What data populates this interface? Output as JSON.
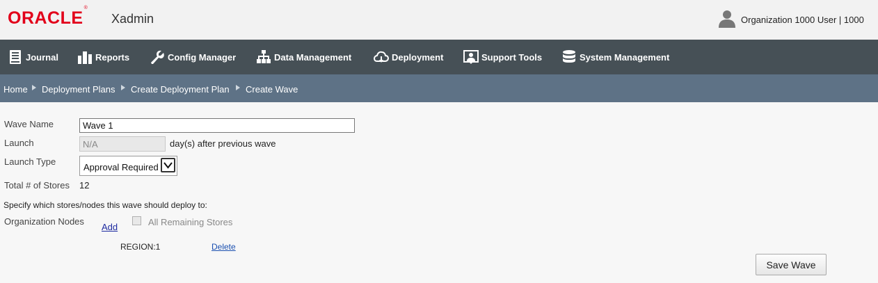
{
  "header": {
    "brand": "ORACLE",
    "trademark": "®",
    "app_name": "Xadmin",
    "user_label": "Organization 1000 User | 1000"
  },
  "nav": {
    "items": [
      {
        "label": "Journal",
        "icon": "journal-icon"
      },
      {
        "label": "Reports",
        "icon": "reports-icon"
      },
      {
        "label": "Config Manager",
        "icon": "wrench-icon"
      },
      {
        "label": "Data Management",
        "icon": "hierarchy-icon"
      },
      {
        "label": "Deployment",
        "icon": "cloud-download-icon"
      },
      {
        "label": "Support Tools",
        "icon": "support-icon"
      },
      {
        "label": "System Management",
        "icon": "database-icon"
      }
    ]
  },
  "breadcrumb": [
    "Home",
    "Deployment Plans",
    "Create Deployment Plan",
    "Create Wave"
  ],
  "form": {
    "wave_name_label": "Wave Name",
    "wave_name_value": "Wave 1",
    "launch_label": "Launch",
    "launch_value": "N/A",
    "launch_suffix": "day(s) after previous wave",
    "launch_type_label": "Launch Type",
    "launch_type_value": "Approval Required",
    "total_stores_label": "Total # of Stores",
    "total_stores_value": "12",
    "instructions": "Specify which stores/nodes this wave should deploy to:",
    "org_nodes_label": "Organization Nodes",
    "add_link": "Add",
    "all_remaining_label": "All Remaining Stores",
    "node_name": "REGION:1",
    "delete_link": "Delete",
    "save_button": "Save Wave"
  },
  "colors": {
    "brand_red": "#e2001a",
    "nav_bg": "#465056",
    "breadcrumb_bg": "#5e7286",
    "link": "#1a4fb0"
  }
}
